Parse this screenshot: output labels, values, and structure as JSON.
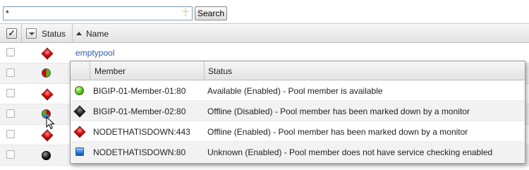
{
  "search": {
    "value": "*",
    "button_label": "Search"
  },
  "table": {
    "headers": {
      "status": "Status",
      "name": "Name"
    },
    "rows": [
      {
        "name": "emptypool",
        "icon": "red-diamond-icon"
      },
      {
        "name": "",
        "icon": "red-green-split-circle-icon"
      },
      {
        "name": "",
        "icon": "red-diamond-icon"
      },
      {
        "name": "",
        "icon": "multicolor-circle-icon"
      },
      {
        "name": "",
        "icon": "red-diamond-icon"
      },
      {
        "name": "",
        "icon": "black-circle-icon"
      }
    ]
  },
  "popup": {
    "headers": {
      "member": "Member",
      "status": "Status"
    },
    "rows": [
      {
        "member": "BIGIP-01-Member-01:80",
        "status": "Available (Enabled) - Pool member is available",
        "icon": "green-circle-icon"
      },
      {
        "member": "BIGIP-01-Member-02:80",
        "status": "Offline (Disabled) - Pool member has been marked down by a monitor",
        "icon": "black-diamond-icon"
      },
      {
        "member": "NODETHATISDOWN:443",
        "status": "Offline (Enabled) - Pool member has been marked down by a monitor",
        "icon": "red-diamond-icon"
      },
      {
        "member": "NODETHATISDOWN:80",
        "status": "Unknown (Enabled) - Pool member does not have service checking enabled",
        "icon": "blue-square-icon"
      }
    ]
  },
  "colors": {
    "link": "#2a5db0",
    "available": "#56c01a",
    "offline": "#d10000",
    "unknown": "#2c7be0"
  }
}
